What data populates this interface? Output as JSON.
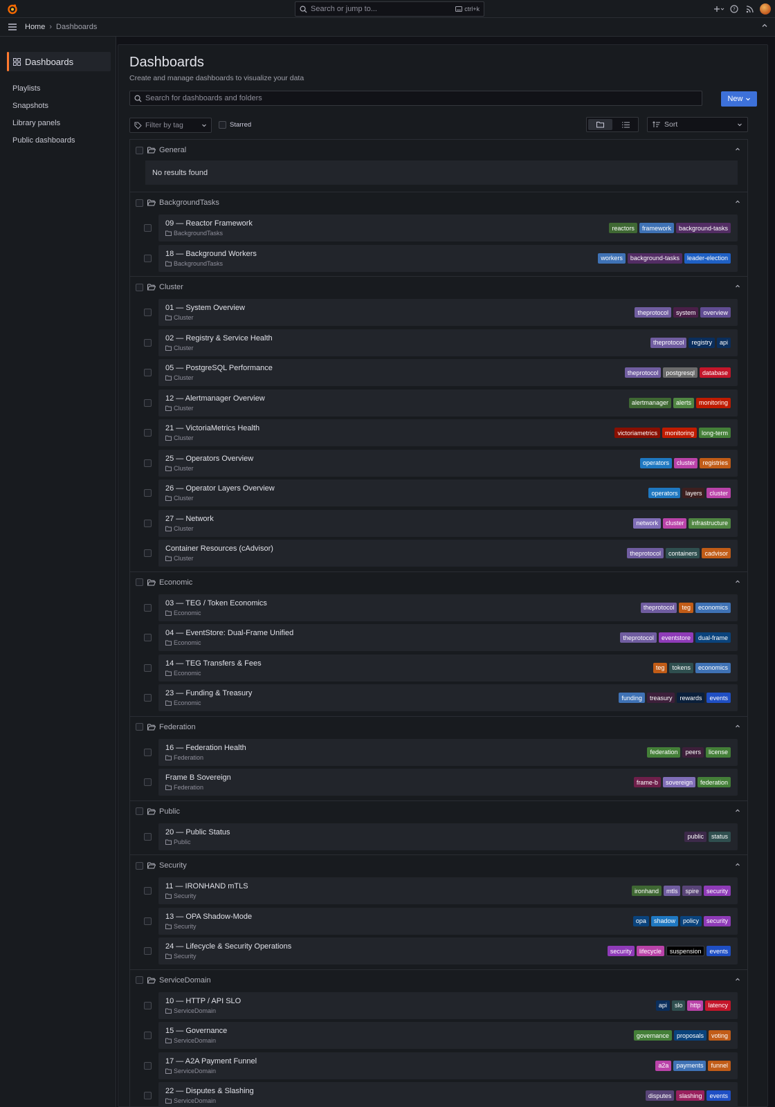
{
  "topbar": {
    "search_placeholder": "Search or jump to...",
    "shortcut": "ctrl+k"
  },
  "breadcrumb": {
    "home": "Home",
    "current": "Dashboards"
  },
  "sidebar": {
    "active": "Dashboards",
    "items": [
      "Playlists",
      "Snapshots",
      "Library panels",
      "Public dashboards"
    ]
  },
  "page": {
    "title": "Dashboards",
    "subtitle": "Create and manage dashboards to visualize your data",
    "search_placeholder": "Search for dashboards and folders",
    "new_label": "New",
    "filter_label": "Filter by tag",
    "starred_label": "Starred",
    "sort_label": "Sort",
    "empty_text": "No results found"
  },
  "tag_colors": {
    "reactors": "#3f6833",
    "framework": "#3f72b5",
    "background-tasks": "#532d64",
    "workers": "#3f72b5",
    "leader-election": "#1f60c4",
    "theprotocol": "#705da0",
    "system": "#4a1f48",
    "overview": "#614d93",
    "registry": "#0a2e5c",
    "api": "#0a2e5c",
    "postgresql": "#6b6b6b",
    "database": "#c4162a",
    "alertmanager": "#3f6833",
    "alerts": "#508642",
    "monitoring": "#bf1b00",
    "victoriametrics": "#890f02",
    "long-term": "#447f38",
    "operators": "#1f78c1",
    "cluster": "#ba43a9",
    "registries": "#c15c17",
    "layers": "#3d1f1f",
    "network": "#806eb7",
    "infrastructure": "#508642",
    "containers": "#2f4f4f",
    "cadvisor": "#c15c17",
    "teg": "#c15c17",
    "economics": "#3f72b5",
    "eventstore": "#8f3bb8",
    "dual-frame": "#0a437c",
    "tokens": "#2f4f4f",
    "funding": "#3f72b5",
    "treasury": "#3d1f3a",
    "rewards": "#0a1f3a",
    "events": "#1f4fc4",
    "federation": "#447f38",
    "peers": "#3d1f3a",
    "license": "#447f38",
    "frame-b": "#6e1f4a",
    "sovereign": "#806eb7",
    "public": "#3d2a4a",
    "status": "#2f4f4f",
    "ironhand": "#3f6833",
    "mtls": "#705da0",
    "spire": "#584477",
    "security": "#8f3bb8",
    "opa": "#0a437c",
    "shadow": "#1f78c1",
    "policy": "#0a437c",
    "lifecycle": "#ba43a9",
    "suspension": "#000000",
    "slo": "#2f4f4f",
    "http": "#ba43a9",
    "latency": "#c4162a",
    "governance": "#447f38",
    "proposals": "#0a437c",
    "voting": "#c15c17",
    "a2a": "#ba43a9",
    "payments": "#3f72b5",
    "funnel": "#c15c17",
    "disputes": "#584477",
    "slashing": "#99215e"
  },
  "folders": [
    {
      "name": "General",
      "dashboards": []
    },
    {
      "name": "BackgroundTasks",
      "dashboards": [
        {
          "title": "09 — Reactor Framework",
          "tags": [
            "reactors",
            "framework",
            "background-tasks"
          ]
        },
        {
          "title": "18 — Background Workers",
          "tags": [
            "workers",
            "background-tasks",
            "leader-election"
          ]
        }
      ]
    },
    {
      "name": "Cluster",
      "dashboards": [
        {
          "title": "01 — System Overview",
          "tags": [
            "theprotocol",
            "system",
            "overview"
          ]
        },
        {
          "title": "02 — Registry & Service Health",
          "tags": [
            "theprotocol",
            "registry",
            "api"
          ]
        },
        {
          "title": "05 — PostgreSQL Performance",
          "tags": [
            "theprotocol",
            "postgresql",
            "database"
          ]
        },
        {
          "title": "12 — Alertmanager Overview",
          "tags": [
            "alertmanager",
            "alerts",
            "monitoring"
          ]
        },
        {
          "title": "21 — VictoriaMetrics Health",
          "tags": [
            "victoriametrics",
            "monitoring",
            "long-term"
          ]
        },
        {
          "title": "25 — Operators Overview",
          "tags": [
            "operators",
            "cluster",
            "registries"
          ]
        },
        {
          "title": "26 — Operator Layers Overview",
          "tags": [
            "operators",
            "layers",
            "cluster"
          ]
        },
        {
          "title": "27 — Network",
          "tags": [
            "network",
            "cluster",
            "infrastructure"
          ]
        },
        {
          "title": "Container Resources (cAdvisor)",
          "tags": [
            "theprotocol",
            "containers",
            "cadvisor"
          ]
        }
      ]
    },
    {
      "name": "Economic",
      "dashboards": [
        {
          "title": "03 — TEG / Token Economics",
          "tags": [
            "theprotocol",
            "teg",
            "economics"
          ]
        },
        {
          "title": "04 — EventStore: Dual-Frame Unified",
          "tags": [
            "theprotocol",
            "eventstore",
            "dual-frame"
          ]
        },
        {
          "title": "14 — TEG Transfers & Fees",
          "tags": [
            "teg",
            "tokens",
            "economics"
          ]
        },
        {
          "title": "23 — Funding & Treasury",
          "tags": [
            "funding",
            "treasury",
            "rewards",
            "events"
          ]
        }
      ]
    },
    {
      "name": "Federation",
      "dashboards": [
        {
          "title": "16 — Federation Health",
          "tags": [
            "federation",
            "peers",
            "license"
          ]
        },
        {
          "title": "Frame B Sovereign",
          "tags": [
            "frame-b",
            "sovereign",
            "federation"
          ]
        }
      ]
    },
    {
      "name": "Public",
      "dashboards": [
        {
          "title": "20 — Public Status",
          "tags": [
            "public",
            "status"
          ]
        }
      ]
    },
    {
      "name": "Security",
      "dashboards": [
        {
          "title": "11 — IRONHAND mTLS",
          "tags": [
            "ironhand",
            "mtls",
            "spire",
            "security"
          ]
        },
        {
          "title": "13 — OPA Shadow-Mode",
          "tags": [
            "opa",
            "shadow",
            "policy",
            "security"
          ]
        },
        {
          "title": "24 — Lifecycle & Security Operations",
          "tags": [
            "security",
            "lifecycle",
            "suspension",
            "events"
          ]
        }
      ]
    },
    {
      "name": "ServiceDomain",
      "dashboards": [
        {
          "title": "10 — HTTP / API SLO",
          "tags": [
            "api",
            "slo",
            "http",
            "latency"
          ]
        },
        {
          "title": "15 — Governance",
          "tags": [
            "governance",
            "proposals",
            "voting"
          ]
        },
        {
          "title": "17 — A2A Payment Funnel",
          "tags": [
            "a2a",
            "payments",
            "funnel"
          ]
        },
        {
          "title": "22 — Disputes & Slashing",
          "tags": [
            "disputes",
            "slashing",
            "events"
          ]
        }
      ]
    }
  ]
}
